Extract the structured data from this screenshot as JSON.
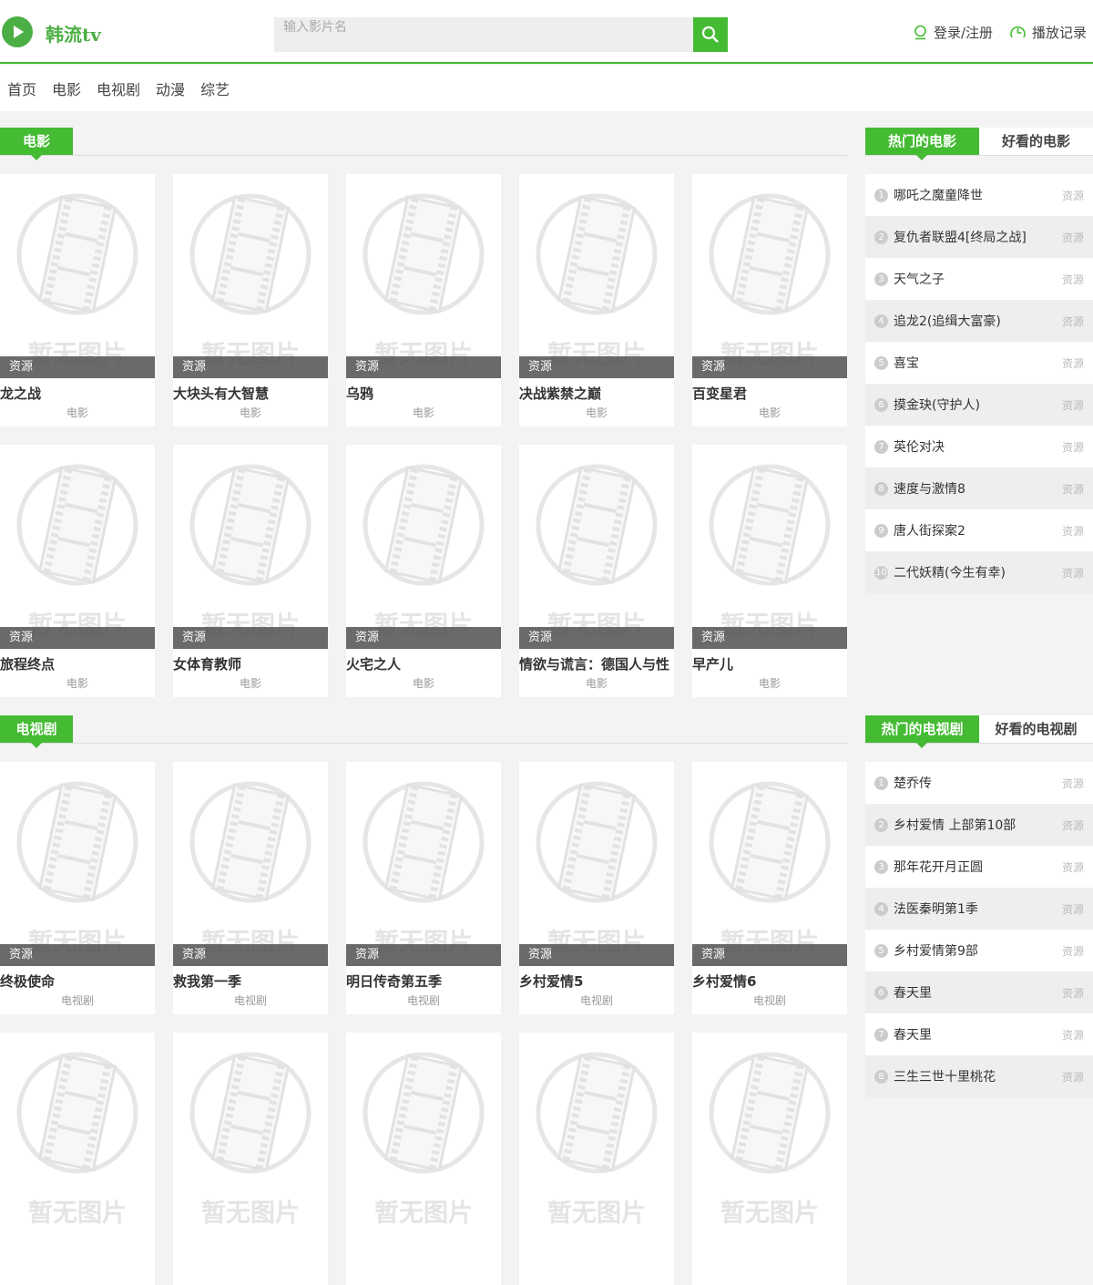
{
  "header": {
    "logo": "韩流tv",
    "search_placeholder": "输入影片名",
    "login": "登录/注册",
    "history": "播放记录"
  },
  "nav": [
    "首页",
    "电影",
    "电视剧",
    "动漫",
    "综艺"
  ],
  "accent": "#44bb33",
  "placeholder_text": "暂无图片",
  "sections": [
    {
      "title": "电影",
      "cards": [
        {
          "title": "龙之战",
          "badge": "资源",
          "cat": "电影"
        },
        {
          "title": "大块头有大智慧",
          "badge": "资源",
          "cat": "电影"
        },
        {
          "title": "乌鸦",
          "badge": "资源",
          "cat": "电影"
        },
        {
          "title": "决战紫禁之巅",
          "badge": "资源",
          "cat": "电影"
        },
        {
          "title": "百变星君",
          "badge": "资源",
          "cat": "电影"
        },
        {
          "title": "旅程终点",
          "badge": "资源",
          "cat": "电影"
        },
        {
          "title": "女体育教师",
          "badge": "资源",
          "cat": "电影"
        },
        {
          "title": "火宅之人",
          "badge": "资源",
          "cat": "电影"
        },
        {
          "title": "情欲与谎言：德国人与性",
          "badge": "资源",
          "cat": "电影"
        },
        {
          "title": "早产儿",
          "badge": "资源",
          "cat": "电影"
        }
      ],
      "side": {
        "tabs": [
          "热门的电影",
          "好看的电影"
        ],
        "items": [
          "哪吒之魔童降世",
          "复仇者联盟4[终局之战]",
          "天气之子",
          "追龙2(追缉大富豪)",
          "喜宝",
          "摸金玦(守护人)",
          "英伦对决",
          "速度与激情8",
          "唐人街探案2",
          "二代妖精(今生有幸)"
        ]
      }
    },
    {
      "title": "电视剧",
      "cards": [
        {
          "title": "终极使命",
          "badge": "资源",
          "cat": "电视剧"
        },
        {
          "title": "救我第一季",
          "badge": "资源",
          "cat": "电视剧"
        },
        {
          "title": "明日传奇第五季",
          "badge": "资源",
          "cat": "电视剧"
        },
        {
          "title": "乡村爱情5",
          "badge": "资源",
          "cat": "电视剧"
        },
        {
          "title": "乡村爱情6",
          "badge": "资源",
          "cat": "电视剧"
        },
        {
          "title": "",
          "badge": "",
          "cat": ""
        },
        {
          "title": "",
          "badge": "",
          "cat": ""
        },
        {
          "title": "",
          "badge": "",
          "cat": ""
        },
        {
          "title": "",
          "badge": "",
          "cat": ""
        },
        {
          "title": "",
          "badge": "",
          "cat": ""
        }
      ],
      "side": {
        "tabs": [
          "热门的电视剧",
          "好看的电视剧"
        ],
        "items": [
          "楚乔传",
          "乡村爱情 上部第10部",
          "那年花开月正圆",
          "法医秦明第1季",
          "乡村爱情第9部",
          "春天里",
          "春天里",
          "三生三世十里桃花"
        ]
      }
    }
  ],
  "resource_label": "资源"
}
